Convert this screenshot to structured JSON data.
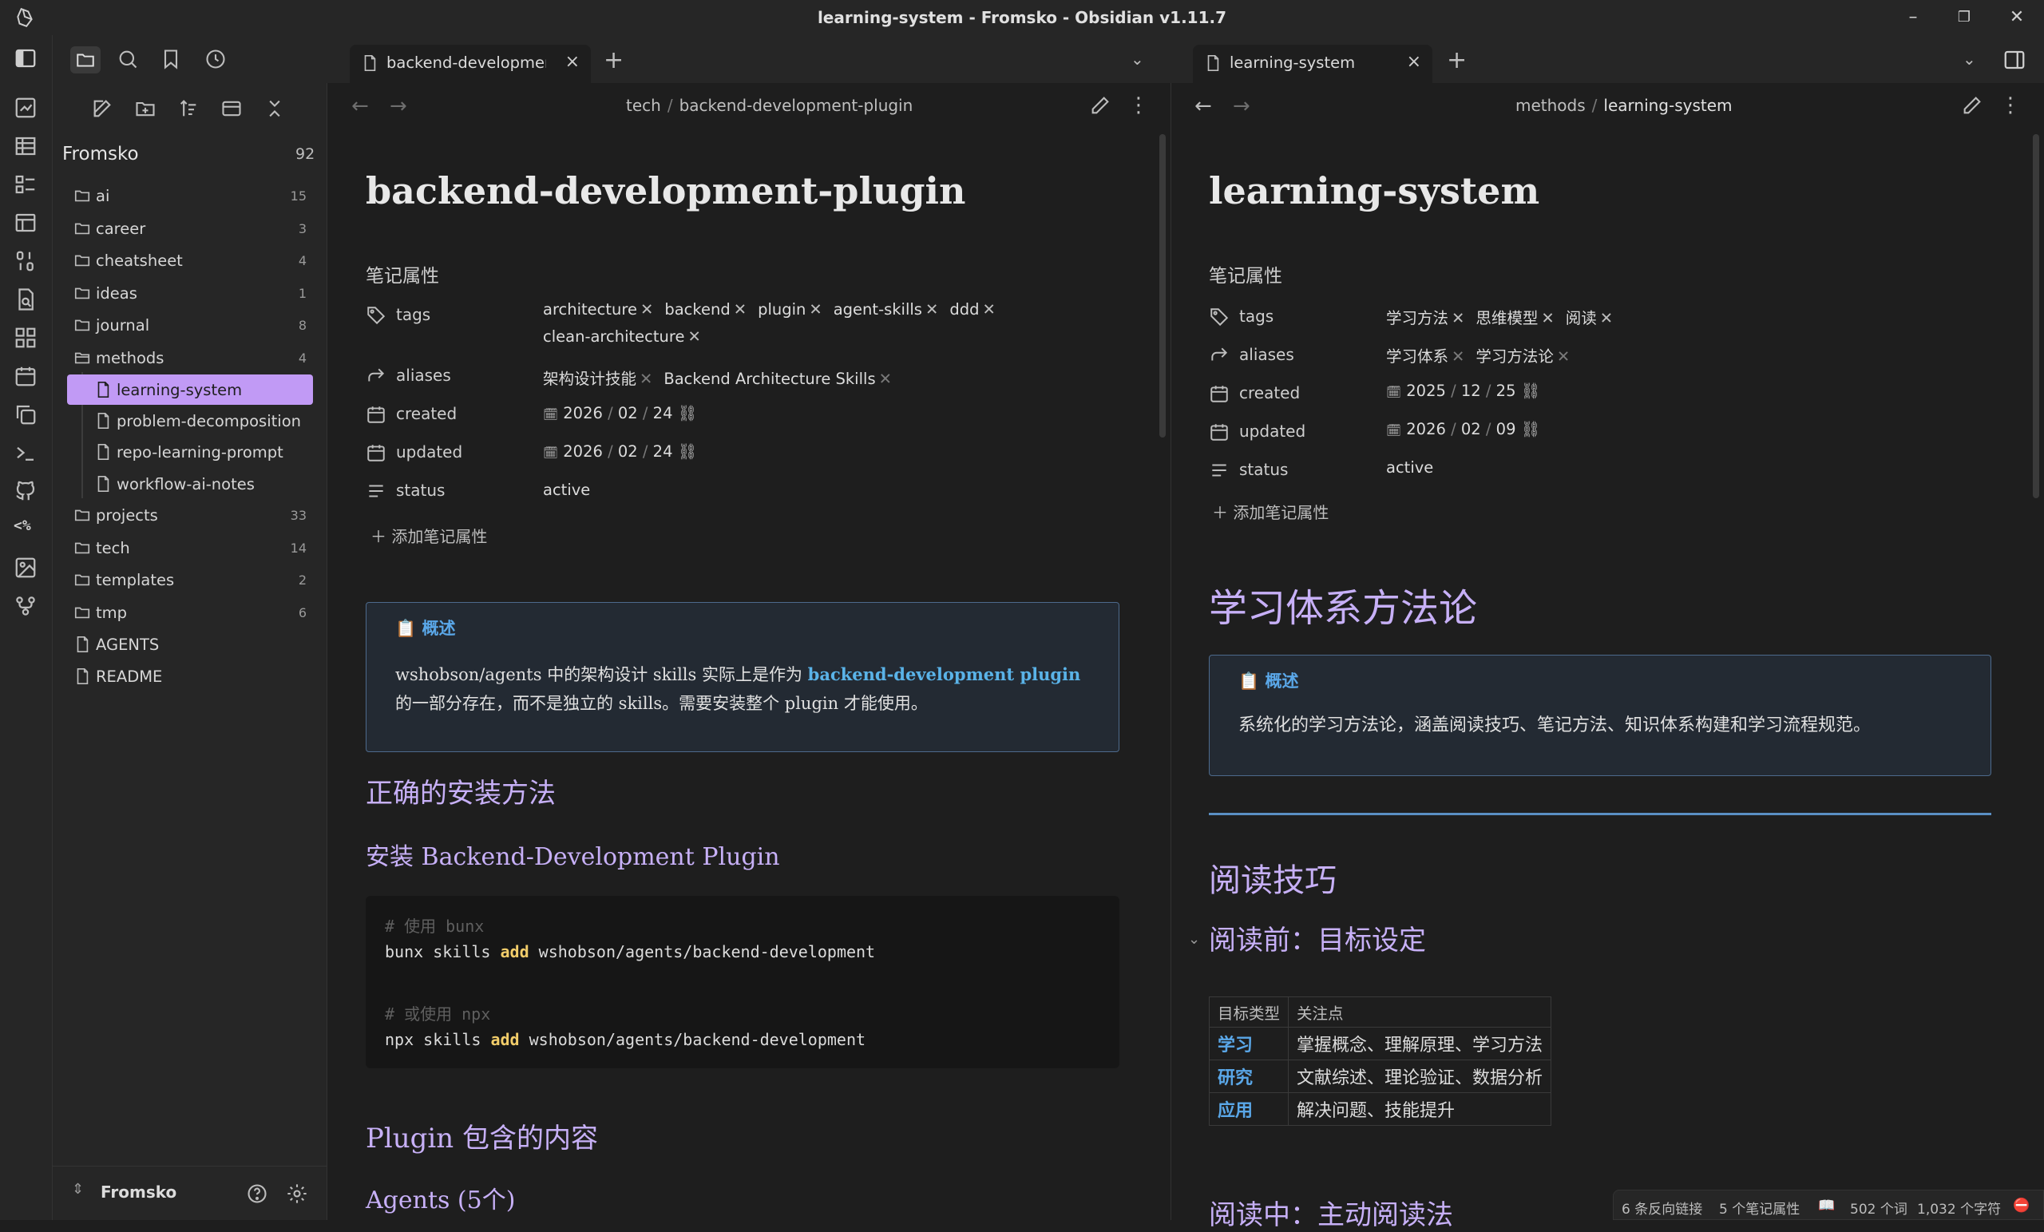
{
  "window": {
    "title": "learning-system - Fromsko - Obsidian v1.11.7"
  },
  "sidebar": {
    "vault_name": "Fromsko",
    "vault_count": "92",
    "tree": [
      {
        "label": "ai",
        "count": "15",
        "type": "folder"
      },
      {
        "label": "career",
        "count": "3",
        "type": "folder"
      },
      {
        "label": "cheatsheet",
        "count": "4",
        "type": "folder"
      },
      {
        "label": "ideas",
        "count": "1",
        "type": "folder"
      },
      {
        "label": "journal",
        "count": "8",
        "type": "folder"
      },
      {
        "label": "methods",
        "count": "4",
        "type": "folder"
      },
      {
        "label": "learning-system",
        "count": "",
        "type": "file"
      },
      {
        "label": "problem-decomposition",
        "count": "",
        "type": "file"
      },
      {
        "label": "repo-learning-prompt",
        "count": "",
        "type": "file"
      },
      {
        "label": "workflow-ai-notes",
        "count": "",
        "type": "file"
      },
      {
        "label": "projects",
        "count": "33",
        "type": "folder"
      },
      {
        "label": "tech",
        "count": "14",
        "type": "folder"
      },
      {
        "label": "templates",
        "count": "2",
        "type": "folder"
      },
      {
        "label": "tmp",
        "count": "6",
        "type": "folder"
      },
      {
        "label": "AGENTS",
        "count": "",
        "type": "file"
      },
      {
        "label": "README",
        "count": "",
        "type": "file"
      }
    ],
    "footer_vault": "Fromsko"
  },
  "left_pane": {
    "tab_label": "backend-development…",
    "breadcrumb": [
      "tech",
      "backend-development-plugin"
    ],
    "title": "backend-development-plugin",
    "properties_title": "笔记属性",
    "props": {
      "tags_key": "tags",
      "tags": [
        "architecture",
        "backend",
        "plugin",
        "agent-skills",
        "ddd",
        "clean-architecture"
      ],
      "aliases_key": "aliases",
      "aliases": [
        "架构设计技能",
        "Backend Architecture Skills"
      ],
      "created_key": "created",
      "created": [
        "2026",
        "02",
        "24"
      ],
      "updated_key": "updated",
      "updated": [
        "2026",
        "02",
        "24"
      ],
      "status_key": "status",
      "status": "active"
    },
    "add_property": "添加笔记属性",
    "callout": {
      "title": "概述",
      "text_1": "wshobson/agents 中的架构设计 skills 实际上是作为 ",
      "link": "backend-development plugin",
      "text_2": "的一部分存在，而不是独立的 skills。需要安装整个 plugin 才能使用。"
    },
    "h_install": "正确的安装方法",
    "h_install_plugin": "安装 Backend-Development Plugin",
    "code": {
      "comment_1": "# 使用 bunx",
      "line_1_cmd": "bunx skills ",
      "line_1_kw": "add",
      "line_1_arg": " wshobson/agents/backend-development",
      "comment_2": "# 或使用 npx",
      "line_2_cmd": "npx skills ",
      "line_2_kw": "add",
      "line_2_arg": " wshobson/agents/backend-development"
    },
    "h_contents": "Plugin 包含的内容",
    "h_agents": "Agents (5个)"
  },
  "right_pane": {
    "tab_label": "learning-system",
    "breadcrumb": [
      "methods",
      "learning-system"
    ],
    "title": "learning-system",
    "properties_title": "笔记属性",
    "props": {
      "tags_key": "tags",
      "tags": [
        "学习方法",
        "思维模型",
        "阅读"
      ],
      "aliases_key": "aliases",
      "aliases": [
        "学习体系",
        "学习方法论"
      ],
      "created_key": "created",
      "created": [
        "2025",
        "12",
        "25"
      ],
      "updated_key": "updated",
      "updated": [
        "2026",
        "02",
        "09"
      ],
      "status_key": "status",
      "status": "active"
    },
    "add_property": "添加笔记属性",
    "h_main": "学习体系方法论",
    "callout": {
      "title": "概述",
      "text": "系统化的学习方法论，涵盖阅读技巧、笔记方法、知识体系构建和学习流程规范。"
    },
    "h_reading": "阅读技巧",
    "h_before": "阅读前：目标设定",
    "table": {
      "headers": [
        "目标类型",
        "关注点"
      ],
      "rows": [
        [
          "学习",
          "掌握概念、理解原理、学习方法"
        ],
        [
          "研究",
          "文献综述、理论验证、数据分析"
        ],
        [
          "应用",
          "解决问题、技能提升"
        ]
      ]
    },
    "h_during": "阅读中：主动阅读法"
  },
  "statusbar": {
    "backlinks": "6 条反向链接",
    "properties": "5 个笔记属性",
    "words": "502 个词",
    "chars": "1,032 个字符"
  },
  "colors": {
    "accent": "#c19af5",
    "heading": "#c7b0f7",
    "callout_blue": "#5aa7e8",
    "code_keyword": "#f2cd6a"
  }
}
